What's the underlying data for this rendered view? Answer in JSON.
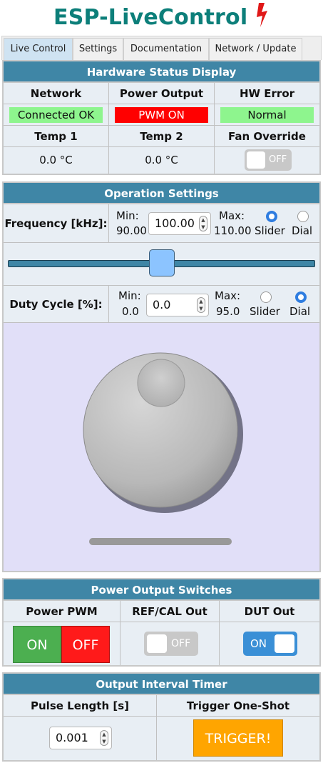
{
  "app": {
    "title": "ESP-LiveControl",
    "accent": "#0d7f7a",
    "bolt_icon": "lightning-bolt-icon",
    "bolt_color": "#e01818"
  },
  "tabs": [
    {
      "label": "Live Control",
      "active": true
    },
    {
      "label": "Settings",
      "active": false
    },
    {
      "label": "Documentation",
      "active": false
    },
    {
      "label": "Network / Update",
      "active": false
    }
  ],
  "status_panel": {
    "title": "Hardware Status Display",
    "headers": {
      "network": "Network",
      "power_output": "Power Output",
      "hw_error": "HW Error"
    },
    "values": {
      "network": "Connected OK",
      "power_output": "PWM ON",
      "hw_error": "Normal"
    },
    "value_colors": {
      "network": "#8ef58e",
      "power_output": "#ff0000",
      "hw_error": "#8ef58e"
    },
    "temp_headers": {
      "temp1": "Temp 1",
      "temp2": "Temp 2",
      "fan_override": "Fan Override"
    },
    "temps": {
      "temp1": "0.0 °C",
      "temp2": "0.0 °C"
    },
    "fan_override": {
      "label": "OFF",
      "state": "off"
    }
  },
  "operation_panel": {
    "title": "Operation Settings",
    "frequency": {
      "label": "Frequency [kHz]:",
      "min_label": "Min:",
      "min_value": "90.00",
      "value": "100.00",
      "max_label": "Max:",
      "max_value": "110.00",
      "modes": [
        {
          "label": "Slider",
          "selected": true
        },
        {
          "label": "Dial",
          "selected": false
        }
      ],
      "slider_fraction": 0.5
    },
    "duty_cycle": {
      "label": "Duty Cycle [%]:",
      "min_label": "Min:",
      "min_value": "0.0",
      "value": "0.0",
      "max_label": "Max:",
      "max_value": "95.0",
      "modes": [
        {
          "label": "Slider",
          "selected": false
        },
        {
          "label": "Dial",
          "selected": true
        }
      ]
    },
    "dial_bg": "#e1dff8"
  },
  "switches_panel": {
    "title": "Power Output Switches",
    "headers": {
      "power_pwm": "Power PWM",
      "refcal": "REF/CAL Out",
      "dut": "DUT Out"
    },
    "pwm_on_label": "ON",
    "pwm_off_label": "OFF",
    "refcal_toggle": {
      "label": "OFF",
      "state": "off"
    },
    "dut_toggle": {
      "label": "ON",
      "state": "on"
    },
    "colors": {
      "on_green": "#4caf50",
      "off_red": "#ff1a1a",
      "toggle_on": "#3a8fd6",
      "toggle_off": "#c8c8c8"
    }
  },
  "timer_panel": {
    "title": "Output Interval Timer",
    "headers": {
      "pulse_length": "Pulse Length [s]",
      "trigger": "Trigger One-Shot"
    },
    "pulse_value": "0.001",
    "trigger_label": "TRIGGER!",
    "trigger_color": "#ffa500"
  }
}
